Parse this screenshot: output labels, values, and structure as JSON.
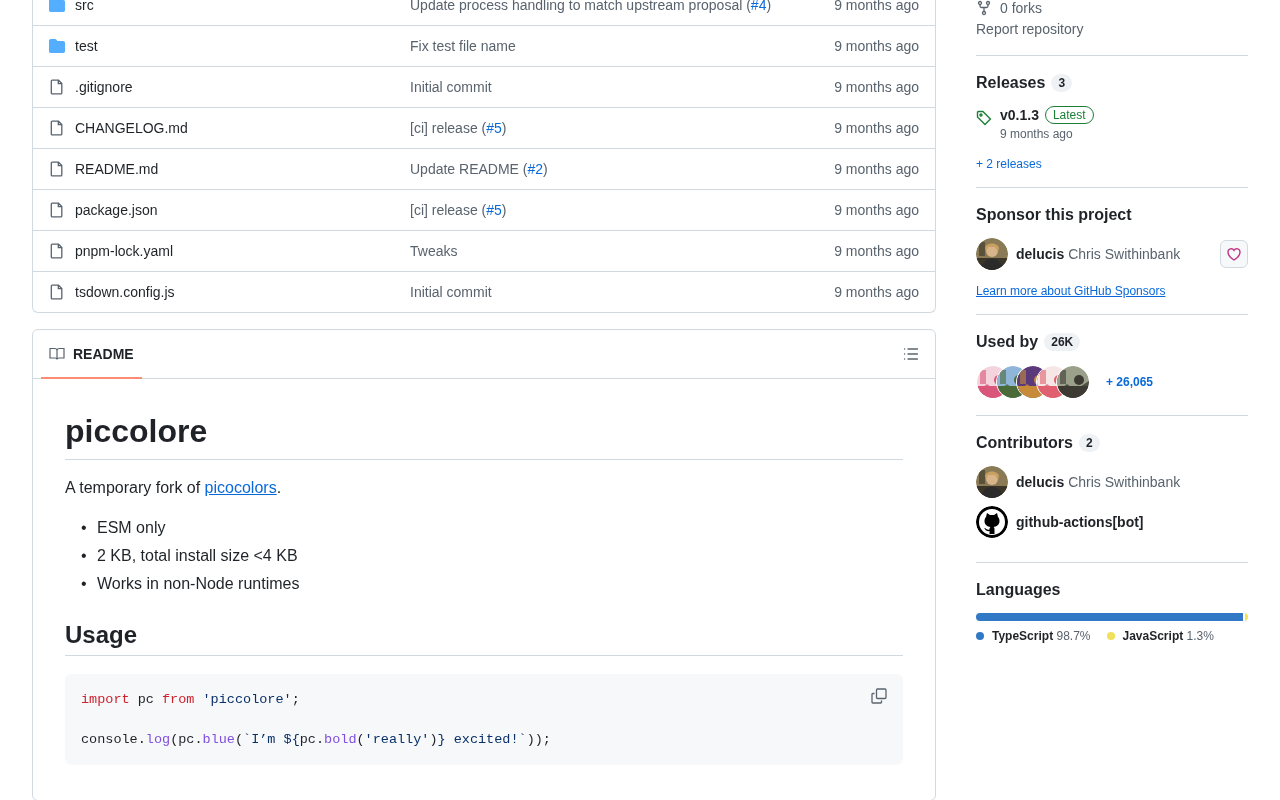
{
  "files": [
    {
      "kind": "folder",
      "name": "src",
      "message": [
        {
          "kind": "text",
          "text": "Update process handling to match upstream proposal ("
        },
        {
          "kind": "link",
          "text": "#4"
        },
        {
          "kind": "text",
          "text": ")"
        }
      ],
      "age": "9 months ago"
    },
    {
      "kind": "folder",
      "name": "test",
      "message": [
        {
          "kind": "text",
          "text": "Fix test file name"
        }
      ],
      "age": "9 months ago"
    },
    {
      "kind": "file",
      "name": ".gitignore",
      "message": [
        {
          "kind": "text",
          "text": "Initial commit"
        }
      ],
      "age": "9 months ago"
    },
    {
      "kind": "file",
      "name": "CHANGELOG.md",
      "message": [
        {
          "kind": "text",
          "text": "[ci] release ("
        },
        {
          "kind": "link",
          "text": "#5"
        },
        {
          "kind": "text",
          "text": ")"
        }
      ],
      "age": "9 months ago"
    },
    {
      "kind": "file",
      "name": "README.md",
      "message": [
        {
          "kind": "text",
          "text": "Update README ("
        },
        {
          "kind": "link",
          "text": "#2"
        },
        {
          "kind": "text",
          "text": ")"
        }
      ],
      "age": "9 months ago"
    },
    {
      "kind": "file",
      "name": "package.json",
      "message": [
        {
          "kind": "text",
          "text": "[ci] release ("
        },
        {
          "kind": "link",
          "text": "#5"
        },
        {
          "kind": "text",
          "text": ")"
        }
      ],
      "age": "9 months ago"
    },
    {
      "kind": "file",
      "name": "pnpm-lock.yaml",
      "message": [
        {
          "kind": "text",
          "text": "Tweaks"
        }
      ],
      "age": "9 months ago"
    },
    {
      "kind": "file",
      "name": "tsdown.config.js",
      "message": [
        {
          "kind": "text",
          "text": "Initial commit"
        }
      ],
      "age": "9 months ago"
    }
  ],
  "readme": {
    "tab": {
      "label": "README",
      "selected": true
    },
    "title": "piccolore",
    "intro": [
      {
        "kind": "text",
        "text": "A temporary fork of "
      },
      {
        "kind": "link",
        "text": "picocolors"
      },
      {
        "kind": "text",
        "text": "."
      }
    ],
    "bullets": [
      {
        "marker": "•",
        "text": "ESM only"
      },
      {
        "marker": "•",
        "text": "2 KB, total install size <4 KB"
      },
      {
        "marker": "•",
        "text": "Works in non-Node runtimes"
      }
    ],
    "usage_heading": "Usage",
    "code": [
      [
        {
          "kind": "keyword",
          "text": "import"
        },
        {
          "kind": "plain",
          "text": " pc "
        },
        {
          "kind": "keyword",
          "text": "from"
        },
        {
          "kind": "string",
          "text": " 'piccolore'"
        },
        {
          "kind": "plain",
          "text": ";"
        }
      ],
      [
        {
          "kind": "plain",
          "text": "console."
        },
        {
          "kind": "func",
          "text": "log"
        },
        {
          "kind": "plain",
          "text": "(pc."
        },
        {
          "kind": "func",
          "text": "blue"
        },
        {
          "kind": "plain",
          "text": "("
        },
        {
          "kind": "string",
          "text": "`I’m ${"
        },
        {
          "kind": "plain",
          "text": "pc."
        },
        {
          "kind": "func",
          "text": "bold"
        },
        {
          "kind": "plain",
          "text": "("
        },
        {
          "kind": "string",
          "text": "'really'"
        },
        {
          "kind": "plain",
          "text": ")"
        },
        {
          "kind": "string",
          "text": "} excited!`"
        },
        {
          "kind": "plain",
          "text": "));"
        }
      ]
    ]
  },
  "about": {
    "forks": "0 forks",
    "report_link": "Report repository"
  },
  "releases": {
    "heading": "Releases",
    "count": "3",
    "latest": {
      "version": "v0.1.3",
      "badge": "Latest",
      "date": "9 months ago"
    },
    "more_link": "+ 2 releases"
  },
  "sponsor": {
    "heading": "Sponsor this project",
    "user": {
      "login": "delucis",
      "name": "Chris Swithinbank"
    },
    "learn_link": "Learn more about GitHub Sponsors"
  },
  "used_by": {
    "heading": "Used by",
    "count": "26K",
    "more": "+ 26,065"
  },
  "contributors": {
    "heading": "Contributors",
    "count": "2",
    "people": [
      {
        "kind": "user",
        "login": "delucis",
        "name": "Chris Swithinbank"
      },
      {
        "kind": "bot",
        "login": "github-actions[bot]"
      }
    ]
  },
  "languages": {
    "heading": "Languages",
    "items": [
      {
        "name": "TypeScript",
        "percent": "98.7%",
        "level": 0.987,
        "color": "#3178c6"
      },
      {
        "name": "JavaScript",
        "percent": "1.3%",
        "level": 0.013,
        "color": "#f1e05a"
      }
    ]
  }
}
